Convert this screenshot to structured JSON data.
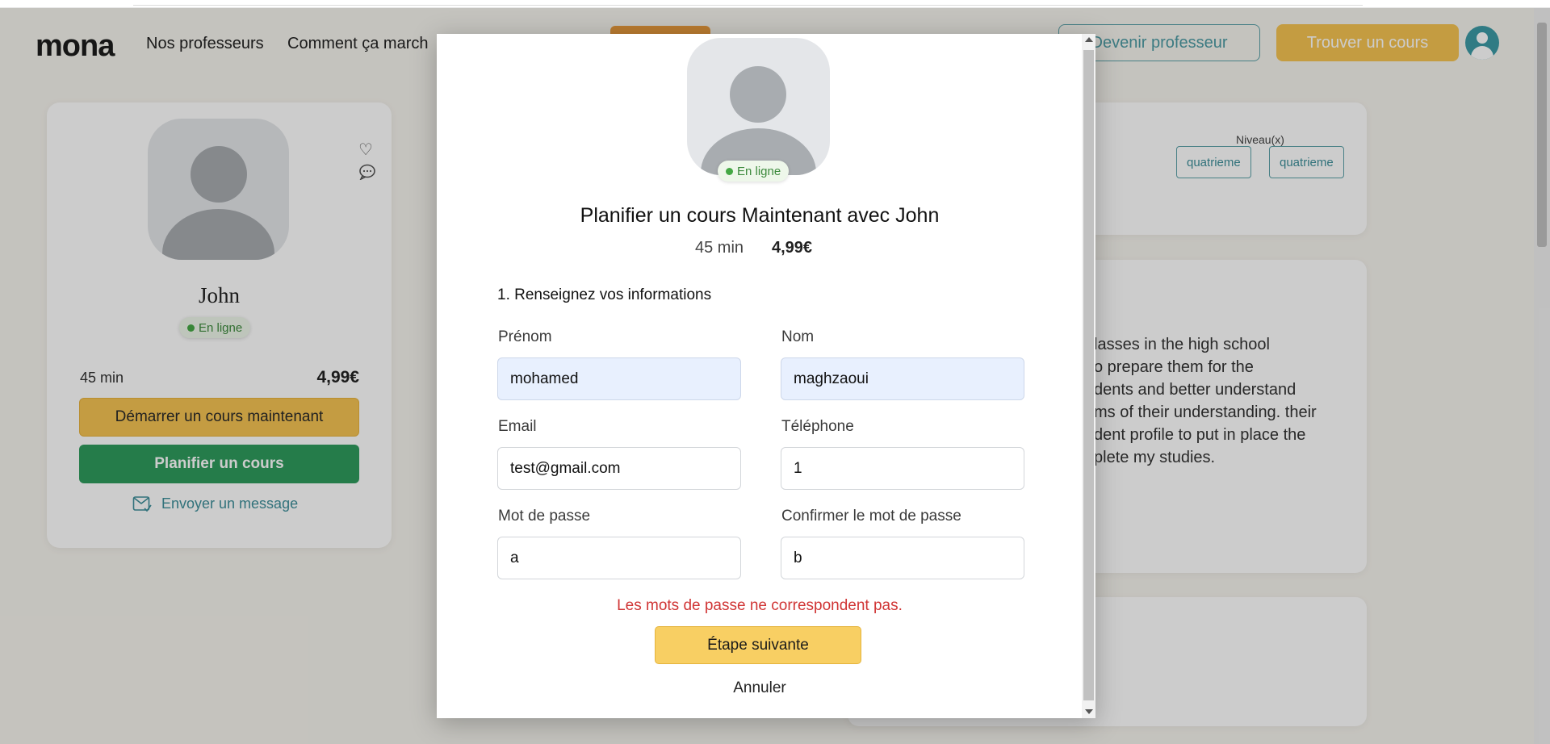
{
  "header": {
    "logo": "mona",
    "nav": [
      "Nos professeurs",
      "Comment ça march"
    ],
    "become_teacher": "Devenir professeur",
    "find_course": "Trouver un cours"
  },
  "profile_card": {
    "name": "John",
    "status": "En ligne",
    "duration": "45 min",
    "price": "4,99€",
    "start_now": "Démarrer un cours maintenant",
    "plan": "Planifier un cours",
    "send_message": "Envoyer un message"
  },
  "levels": {
    "label": "Niveau(x)",
    "tags": [
      "quatrieme",
      "quatrieme"
    ]
  },
  "bio": {
    "lines": [
      "lasses in the high school",
      "o prepare them for the",
      "dents and better understand",
      "ms of their understanding. their",
      "dent profile to put in place the",
      "plete my studies."
    ]
  },
  "modal": {
    "status": "En ligne",
    "title": "Planifier un cours Maintenant avec John",
    "duration": "45 min",
    "price": "4,99€",
    "step": "1. Renseignez vos informations",
    "fields": {
      "prenom": {
        "label": "Prénom",
        "value": "mohamed"
      },
      "nom": {
        "label": "Nom",
        "value": "maghzaoui"
      },
      "email": {
        "label": "Email",
        "value": "test@gmail.com"
      },
      "telephone": {
        "label": "Téléphone",
        "value": "1"
      },
      "password": {
        "label": "Mot de passe",
        "value": "a"
      },
      "confirm": {
        "label": "Confirmer le mot de passe",
        "value": "b"
      }
    },
    "error": "Les mots de passe ne correspondent pas.",
    "next": "Étape suivante",
    "cancel": "Annuler"
  },
  "colors": {
    "accent_yellow": "#f6c452",
    "accent_teal": "#4c9aa3",
    "accent_green": "#2f9b5d",
    "error_red": "#d03535",
    "overlay": "rgba(0,0,0,0.2)"
  }
}
